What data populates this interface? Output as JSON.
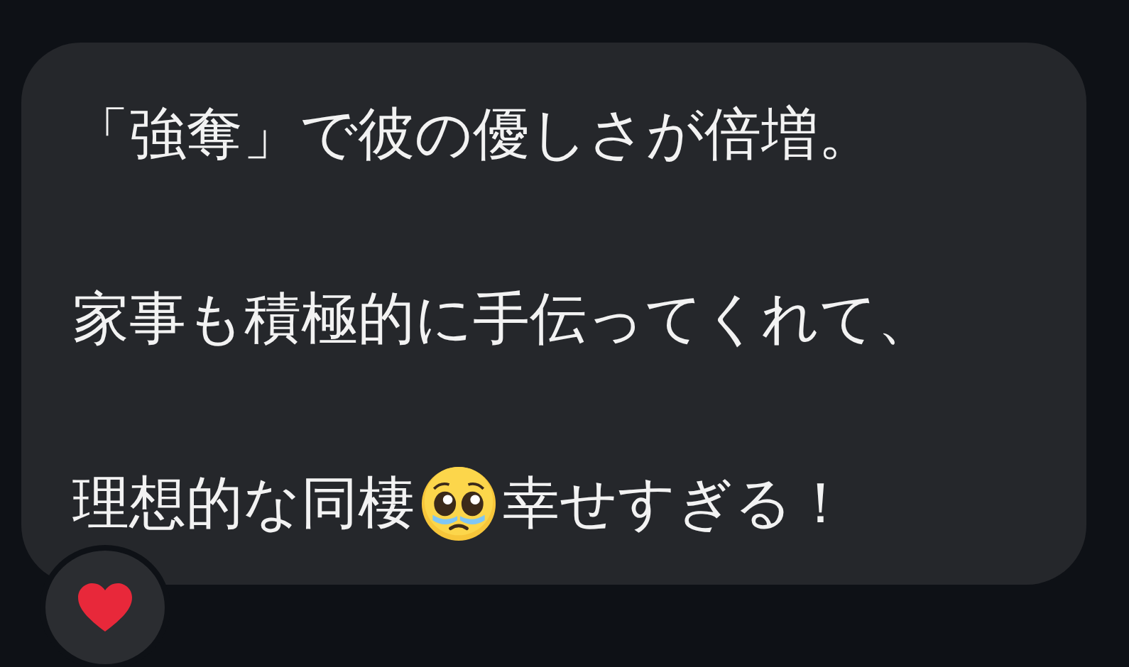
{
  "message": {
    "paragraphs": [
      {
        "segments": [
          {
            "kind": "text",
            "text": "「強奪」で彼の優しさが倍増。"
          }
        ]
      },
      {
        "segments": [
          {
            "kind": "text",
            "text": "家事も積極的に手伝ってくれて、"
          }
        ]
      },
      {
        "segments": [
          {
            "kind": "text",
            "text": "理想的な同棲"
          },
          {
            "kind": "emoji"
          },
          {
            "kind": "text",
            "text": " 幸せすぎる！"
          }
        ]
      }
    ]
  },
  "reactions": [
    {
      "kind": "heart"
    }
  ]
}
